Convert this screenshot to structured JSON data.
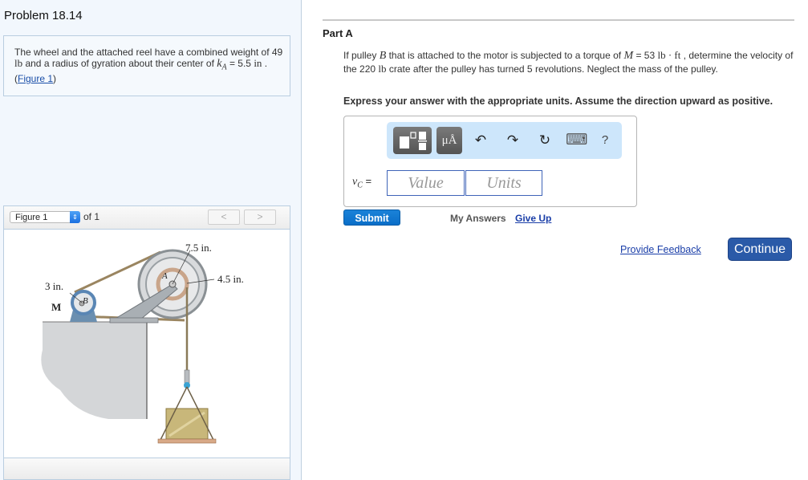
{
  "problem": {
    "title": "Problem 18.14",
    "description_part1": "The wheel and the attached reel have a combined weight of 49 ",
    "weight_unit": "lb",
    "description_part2": " and a radius of gyration about their center of ",
    "k_symbol": "k",
    "k_subscript": "A",
    "description_part3": " = 5.5 ",
    "k_unit": "in",
    "description_part4": " .(",
    "figure_link": "Figure 1",
    "description_part5": ")"
  },
  "figure_panel": {
    "selected_figure": "Figure 1",
    "of_label": "of 1",
    "prev_label": "<",
    "next_label": ">",
    "labels": {
      "outer_radius": "7.5 in.",
      "reel_radius": "4.5 in.",
      "pulley_radius": "3 in.",
      "motor": "M",
      "pulley": "B",
      "wheel_center": "A"
    }
  },
  "part": {
    "title": "Part A",
    "q1": "If pulley ",
    "q_B": "B",
    "q2": " that is attached to the motor is subjected to a torque of ",
    "q_M": "M",
    "q3": " = 53 ",
    "q_torque_unit": "lb · ft",
    "q4": " , determine the velocity of the 220 ",
    "q_lb": "lb",
    "q5": " crate after the pulley has turned 5 revolutions. Neglect the mass of the pulley.",
    "instructions": "Express your answer with the appropriate units. Assume the direction upward as positive."
  },
  "answer": {
    "variable": "v",
    "variable_sub": "C",
    "equals": " =",
    "value_placeholder": "Value",
    "units_placeholder": "Units",
    "toolbar": {
      "templates_icon": "templates-icon",
      "units_label": "μÅ",
      "undo_icon": "↶",
      "redo_icon": "↷",
      "reset_icon": "↻",
      "keyboard_icon": "⌨",
      "help_label": "?"
    }
  },
  "actions": {
    "submit": "Submit",
    "my_answers": "My Answers",
    "give_up": "Give Up",
    "provide_feedback": "Provide Feedback",
    "continue": "Continue"
  }
}
